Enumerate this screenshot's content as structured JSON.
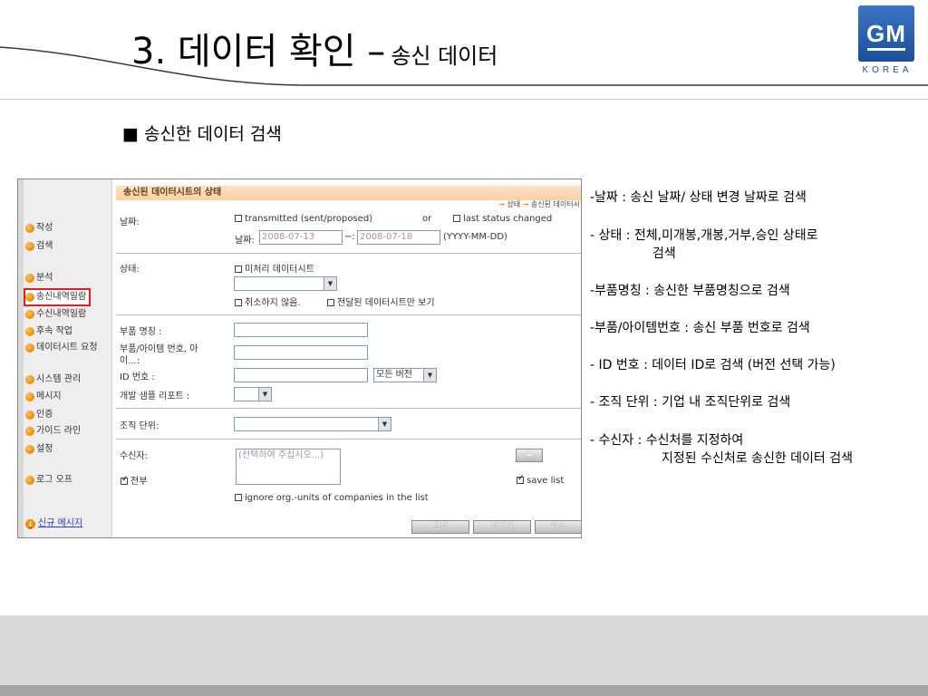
{
  "slide": {
    "title_main": "3. 데이터 확인 –",
    "title_sub": "송신 데이터",
    "heading": "■ 송신한 데이터 검색",
    "logo": {
      "brand": "GM",
      "country": "KOREA"
    }
  },
  "app": {
    "sidebar": {
      "items": [
        "작성",
        "검색",
        "분석",
        "송신내역일람",
        "수신내역일람",
        "후속 작업",
        "데이터시트 요청",
        "시스템 관리",
        "메시지",
        "인증",
        "가이드 라인",
        "설정",
        "로그 오프"
      ],
      "active_item": "송신내역일람",
      "new_message": "신규 메시지"
    },
    "status_bar": {
      "title": "송신된 데이터시트의 상태",
      "legend_state": "상태",
      "legend_sent": "송신된 데이터시"
    },
    "date_section": {
      "label": "날짜:",
      "opt_transmitted": "transmitted (sent/proposed)",
      "or": "or",
      "opt_last_status": "last status changed",
      "date_label": "날짜:",
      "date_from": "2008-07-13",
      "tilde": "~:",
      "date_to": "2008-07-18",
      "format": "(YYYY-MM-DD)"
    },
    "status_section": {
      "label": "상태:",
      "opt_unprocessed": "미처리 데이터시트",
      "opt_not_cancelled": "취소하지 않음.",
      "opt_delivered_only": "전달된 데이터시트만 보기"
    },
    "part_section": {
      "part_name": "부품 명칭 :",
      "part_no_1": "부품/아이템 번호, 아",
      "part_no_2": "이...:",
      "id_no": "ID 번호 :",
      "version_select": "모든 버전",
      "dev_report": "개발 샘플 리포트 :"
    },
    "org_section": {
      "label": "조직 단위:"
    },
    "recipient_section": {
      "label": "수신자:",
      "placeholder": "(선택하여 주십시오...)",
      "all_label": "전부",
      "add_button": "+",
      "save_list": "save list",
      "ignore_org": "ignore org.-units of companies in the list"
    },
    "buttons": {
      "search": "검색",
      "export": "보내기",
      "cancel": "취소"
    }
  },
  "descriptions": [
    {
      "text": "-날짜 : 송신 날짜/ 상태 변경 날짜로 검색",
      "cont": ""
    },
    {
      "text": "- 상태 : 전체,미개봉,개봉,거부,승인 상태로",
      "cont": "검색"
    },
    {
      "text": "-부품명칭 : 송신한 부품명칭으로 검색",
      "cont": ""
    },
    {
      "text": "-부품/아이템번호 : 송신 부품 번호로 검색",
      "cont": ""
    },
    {
      "text": "- ID 번호 : 데이터 ID로 검색 (버전 선택 가능)",
      "cont": ""
    },
    {
      "text": "- 조직 단위 : 기업 내 조직단위로 검색",
      "cont": ""
    },
    {
      "text": "- 수신자 : 수신처를 지정하여",
      "cont": "지정된 수신처로 송신한 데이터 검색"
    }
  ]
}
